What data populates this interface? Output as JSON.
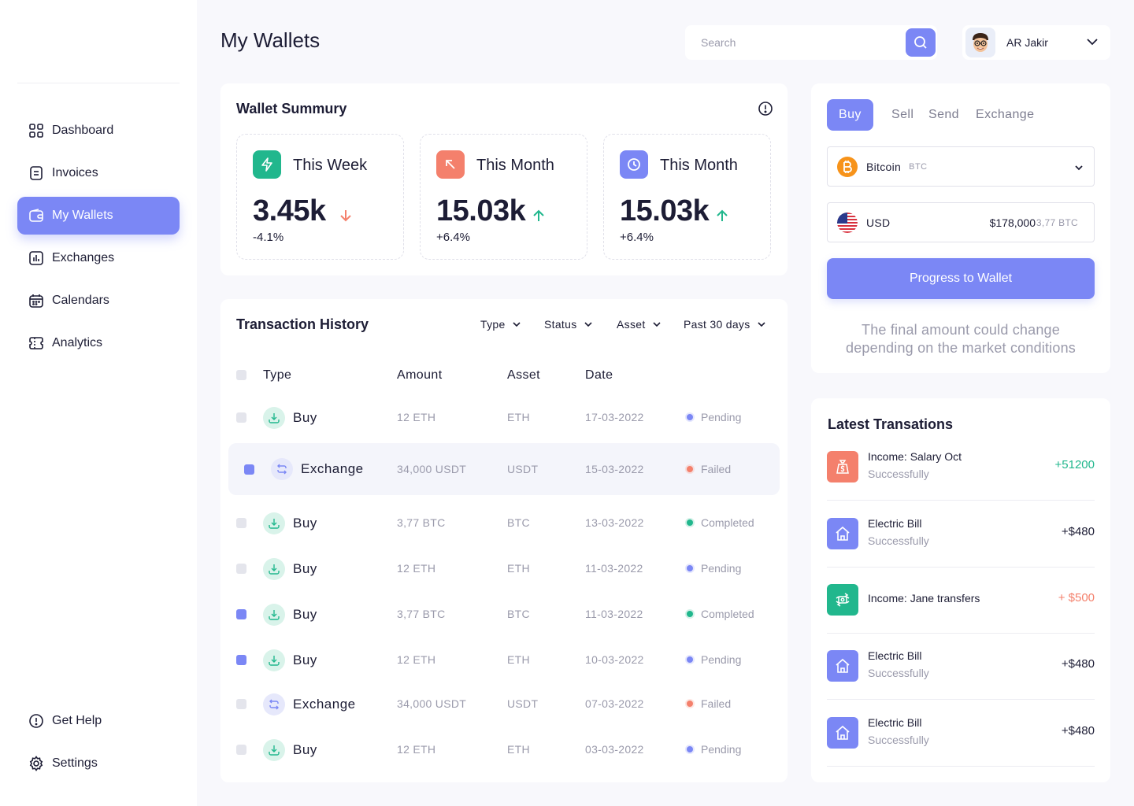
{
  "colors": {
    "accent": "#7b87f5",
    "green": "#21b78d",
    "coral": "#f4806c",
    "text": "#1d1d35",
    "muted": "#9a9aab"
  },
  "header": {
    "title": "My Wallets",
    "search_placeholder": "Search",
    "user_name": "AR Jakir"
  },
  "sidebar": {
    "items": [
      {
        "label": "Dashboard",
        "icon": "grid-icon"
      },
      {
        "label": "Invoices",
        "icon": "invoice-icon"
      },
      {
        "label": "My Wallets",
        "icon": "wallet-icon",
        "active": true
      },
      {
        "label": "Exchanges",
        "icon": "chart-icon"
      },
      {
        "label": "Calendars",
        "icon": "calendar-icon"
      },
      {
        "label": "Analytics",
        "icon": "ticket-icon"
      }
    ],
    "bottom": [
      {
        "label": "Get Help",
        "icon": "info-icon"
      },
      {
        "label": "Settings",
        "icon": "gear-icon"
      }
    ]
  },
  "summary": {
    "title": "Wallet Summury",
    "stats": [
      {
        "label": "This Week",
        "value": "3.45k",
        "change": "-4.1%",
        "direction": "down",
        "icon": "bolt-icon",
        "color": "#21b78d"
      },
      {
        "label": "This Month",
        "value": "15.03k",
        "change": "+6.4%",
        "direction": "up",
        "icon": "arrow-up-left-icon",
        "color": "#f4806c"
      },
      {
        "label": "This Month",
        "value": "15.03k",
        "change": "+6.4%",
        "direction": "up",
        "icon": "clock-icon",
        "color": "#7b87f5"
      }
    ]
  },
  "history": {
    "title": "Transaction History",
    "filters": [
      "Type",
      "Status",
      "Asset",
      "Past 30 days"
    ],
    "columns": [
      "Type",
      "Amount",
      "Asset",
      "Date"
    ],
    "rows": [
      {
        "type": "Buy",
        "amount": "12 ETH",
        "asset": "ETH",
        "date": "17-03-2022",
        "status": "Pending",
        "checked": false
      },
      {
        "type": "Exchange",
        "amount": "34,000 USDT",
        "asset": "USDT",
        "date": "15-03-2022",
        "status": "Failed",
        "checked": true,
        "highlighted": true
      },
      {
        "type": "Buy",
        "amount": "3,77 BTC",
        "asset": "BTC",
        "date": "13-03-2022",
        "status": "Completed",
        "checked": false
      },
      {
        "type": "Buy",
        "amount": "12 ETH",
        "asset": "ETH",
        "date": "11-03-2022",
        "status": "Pending",
        "checked": false
      },
      {
        "type": "Buy",
        "amount": "3,77 BTC",
        "asset": "BTC",
        "date": "11-03-2022",
        "status": "Completed",
        "checked": true
      },
      {
        "type": "Buy",
        "amount": "12 ETH",
        "asset": "ETH",
        "date": "10-03-2022",
        "status": "Pending",
        "checked": true
      },
      {
        "type": "Exchange",
        "amount": "34,000 USDT",
        "asset": "USDT",
        "date": "07-03-2022",
        "status": "Failed",
        "checked": false
      },
      {
        "type": "Buy",
        "amount": "12 ETH",
        "asset": "ETH",
        "date": "03-03-2022",
        "status": "Pending",
        "checked": false
      }
    ]
  },
  "trade": {
    "tabs": [
      "Buy",
      "Sell",
      "Send",
      "Exchange"
    ],
    "coin": {
      "name": "Bitcoin",
      "symbol": "BTC"
    },
    "currency": {
      "name": "USD",
      "amount": "$178,000",
      "equivalent": "3,77 BTC"
    },
    "button": "Progress to Wallet",
    "note": "The final amount could change depending on the market conditions"
  },
  "latest": {
    "title": "Latest Transations",
    "items": [
      {
        "title": "Income: Salary Oct",
        "sub": "Successfully",
        "amount": "+51200",
        "amount_color": "#21b78d",
        "icon": "money-bag-icon",
        "color": "#f4806c"
      },
      {
        "title": "Electric Bill",
        "sub": "Successfully",
        "amount": "+$480",
        "amount_color": "#1d1d35",
        "icon": "home-icon",
        "color": "#7b87f5"
      },
      {
        "title": "Income: Jane transfers",
        "sub": "",
        "amount": "+ $500",
        "amount_color": "#f4806c",
        "icon": "transfer-icon",
        "color": "#21b78d"
      },
      {
        "title": "Electric Bill",
        "sub": "Successfully",
        "amount": "+$480",
        "amount_color": "#1d1d35",
        "icon": "home-icon",
        "color": "#7b87f5"
      },
      {
        "title": "Electric Bill",
        "sub": "Successfully",
        "amount": "+$480",
        "amount_color": "#1d1d35",
        "icon": "home-icon",
        "color": "#7b87f5"
      }
    ]
  }
}
